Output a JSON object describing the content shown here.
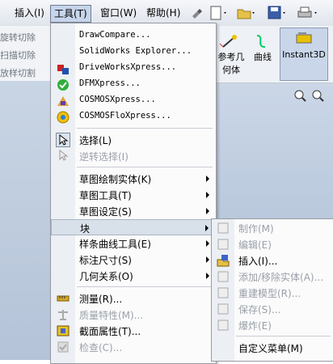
{
  "menubar": {
    "items": [
      {
        "label": "插入(I)"
      },
      {
        "label": "工具(T)"
      },
      {
        "label": "窗口(W)"
      },
      {
        "label": "帮助(H)"
      }
    ]
  },
  "left_panel": {
    "items": [
      "旋转切除",
      "扫描切除",
      "放样切割"
    ]
  },
  "right_panel": {
    "buttons": [
      {
        "label": "参考几\n何体"
      },
      {
        "label": "曲线"
      },
      {
        "label": "Instant3D"
      }
    ]
  },
  "tools_menu": {
    "items": [
      {
        "label": "DrawCompare...",
        "icon": "none"
      },
      {
        "label": "SolidWorks Explorer...",
        "icon": "none"
      },
      {
        "label": "DriveWorksXpress...",
        "icon": "driveworks-icon"
      },
      {
        "label": "DFMXpress...",
        "icon": "checkmark-icon"
      },
      {
        "label": "COSMOSXpress...",
        "icon": "cosmos-icon"
      },
      {
        "label": "COSMOSFloXpress...",
        "icon": "flow-icon"
      },
      {
        "label": "选择(L)",
        "icon": "select-cursor-icon"
      },
      {
        "label": "逆转选择(I)",
        "icon": "invert-select-icon"
      },
      {
        "label": "草图绘制实体(K)",
        "icon": "none"
      },
      {
        "label": "草图工具(T)",
        "icon": "none"
      },
      {
        "label": "草图设定(S)",
        "icon": "none"
      },
      {
        "label": "块",
        "icon": "none"
      },
      {
        "label": "样条曲线工具(E)",
        "icon": "none"
      },
      {
        "label": "标注尺寸(S)",
        "icon": "none"
      },
      {
        "label": "几何关系(O)",
        "icon": "none"
      },
      {
        "label": "测量(R)...",
        "icon": "measure-icon"
      },
      {
        "label": "质量特性(M)...",
        "icon": "mass-properties-icon"
      },
      {
        "label": "截面属性(T)...",
        "icon": "section-properties-icon"
      },
      {
        "label": "检查(C)...",
        "icon": "check-icon"
      }
    ]
  },
  "block_submenu": {
    "items": [
      {
        "label": "制作(M)"
      },
      {
        "label": "编辑(E)"
      },
      {
        "label": "插入(I)..."
      },
      {
        "label": "添加/移除实体(A)..."
      },
      {
        "label": "重建模型(R)..."
      },
      {
        "label": "保存(S)..."
      },
      {
        "label": "爆炸(E)"
      },
      {
        "label": "自定义菜单(M)"
      }
    ]
  },
  "colors": {
    "highlight": "#d8e0ea",
    "disabled_text": "#9aa0a8",
    "accent": "#1f5fb5"
  }
}
